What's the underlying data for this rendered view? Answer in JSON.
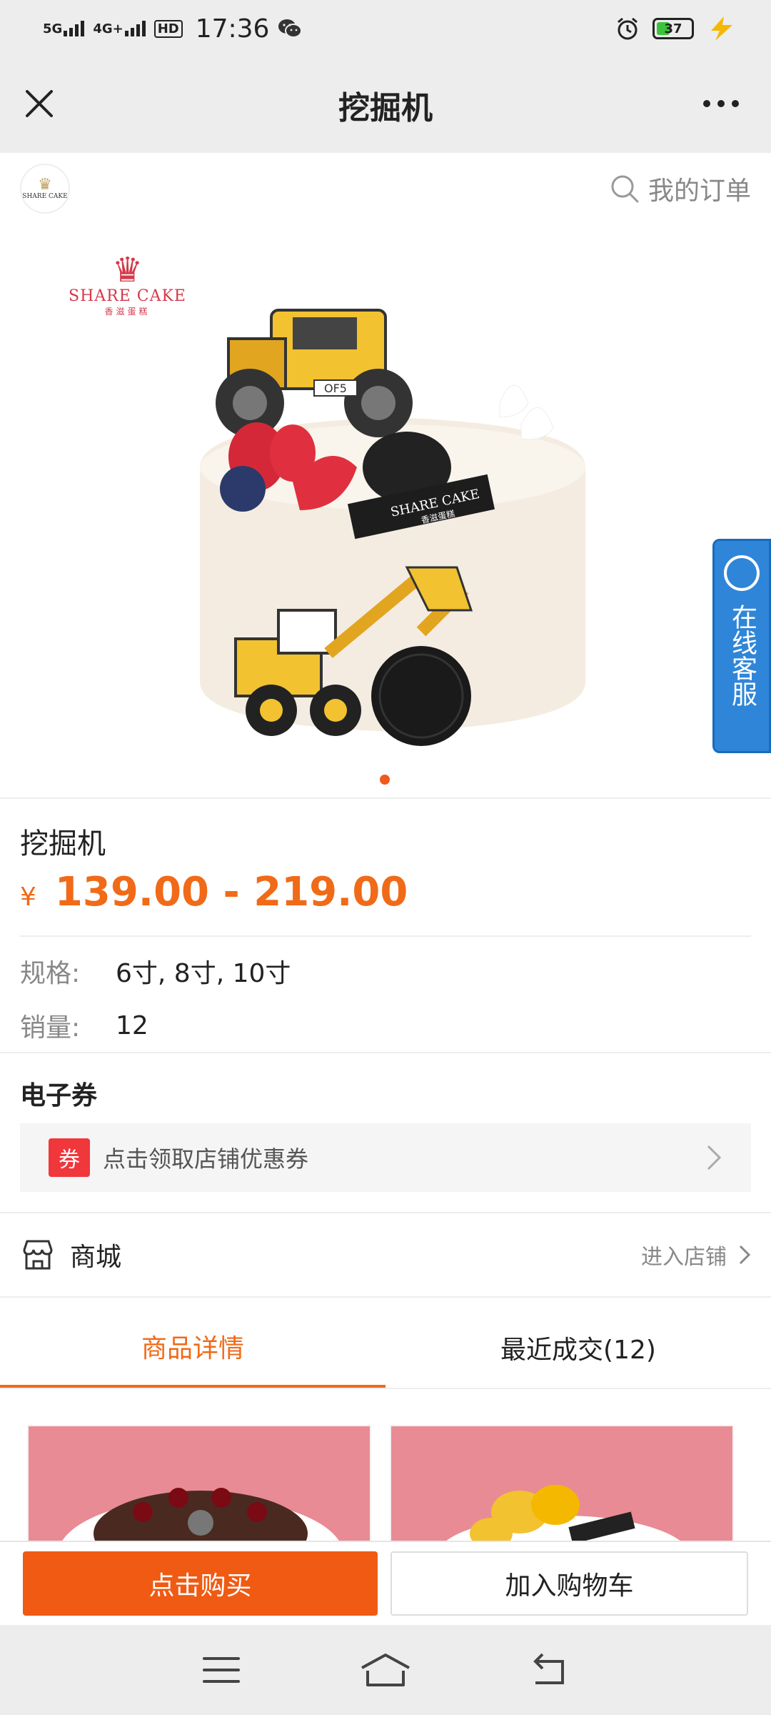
{
  "status_bar": {
    "net1": "5G",
    "net2": "4G+",
    "hd": "HD",
    "time": "17:36",
    "battery": "37"
  },
  "header": {
    "title": "挖掘机",
    "close_icon": "close-icon",
    "more_icon": "more-icon"
  },
  "shop": {
    "logo_text": "SHARE CAKE",
    "my_orders": "我的订单"
  },
  "hero": {
    "brand_name": "SHARE CAKE",
    "brand_sub": "香滋蛋糕",
    "topper_text": "SHARE CAKE",
    "topper_sub": "香滋蛋糕",
    "plate_text": "OF5",
    "service_label": "在线客服"
  },
  "product": {
    "name": "挖掘机",
    "currency": "¥",
    "price": "139.00 - 219.00",
    "spec_label": "规格:",
    "spec_value": "6寸, 8寸, 10寸",
    "sales_label": "销量:",
    "sales_value": "12"
  },
  "coupon": {
    "title": "电子券",
    "badge": "券",
    "text": "点击领取店铺优惠券"
  },
  "store": {
    "name": "商城",
    "enter": "进入店铺"
  },
  "tabs": [
    {
      "label": "商品详情",
      "active": true
    },
    {
      "label": "最近成交(12)",
      "active": false
    }
  ],
  "actions": {
    "buy": "点击购买",
    "cart": "加入购物车"
  },
  "colors": {
    "accent": "#f06a18",
    "buy_button": "#f05a12",
    "service_blue": "#2f86d8",
    "coupon_red": "#f0373c"
  }
}
